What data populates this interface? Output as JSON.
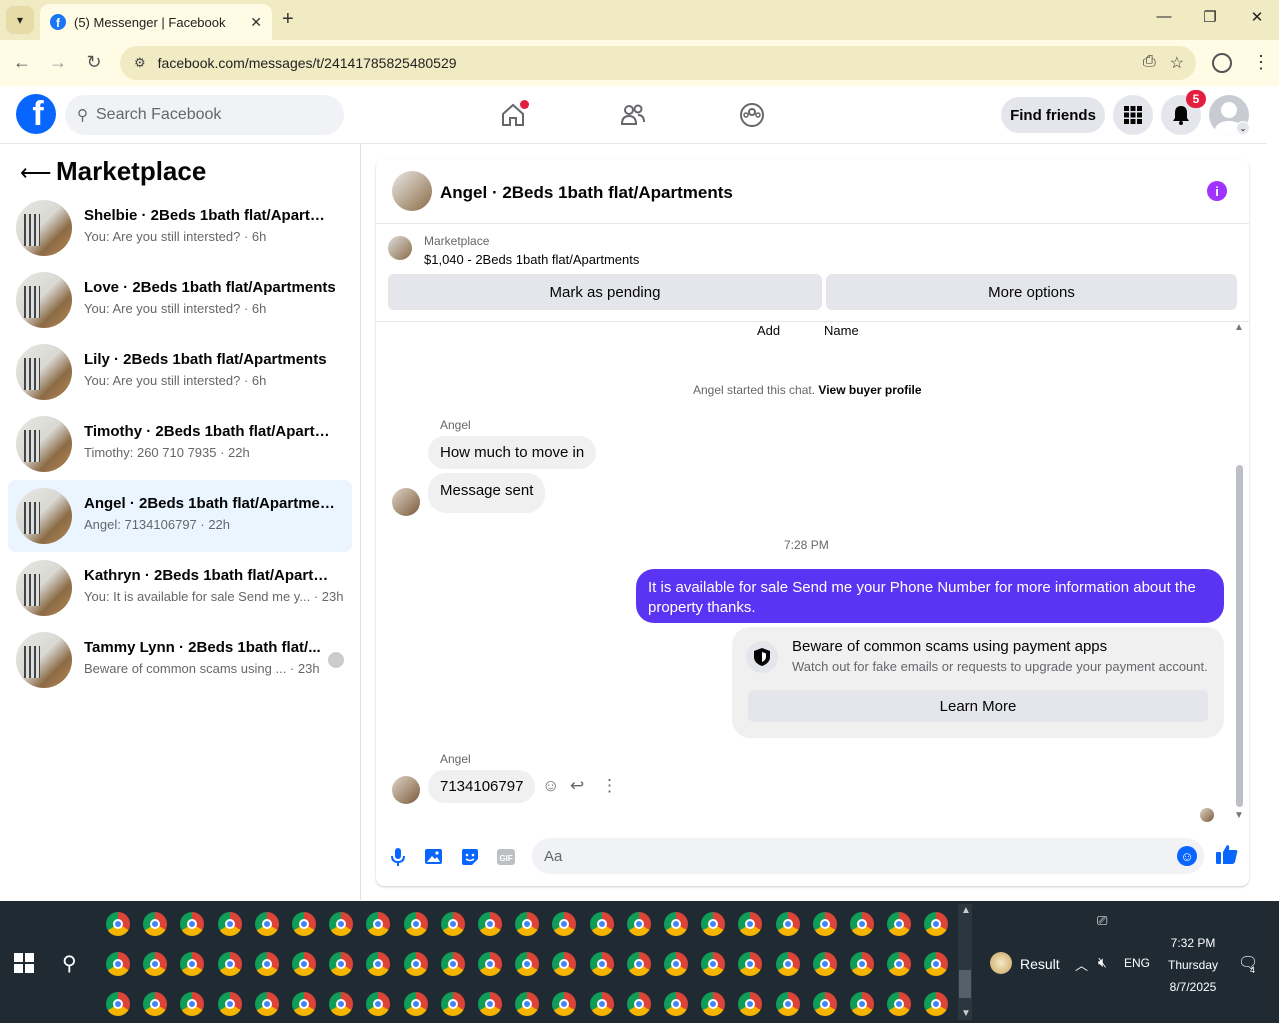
{
  "browser": {
    "tab_title": "(5) Messenger | Facebook",
    "url": "facebook.com/messages/t/24141785825480529",
    "new_tab_icon": "plus-icon"
  },
  "fb": {
    "search_placeholder": "Search Facebook",
    "find_friends": "Find friends",
    "notif_count": "5"
  },
  "sidebar": {
    "title": "Marketplace",
    "conversations": [
      {
        "name": "Shelbie · 2Beds 1bath flat/Apartme...",
        "preview": "You: Are you still intersted? · 6h"
      },
      {
        "name": "Love · 2Beds 1bath flat/Apartments",
        "preview": "You: Are you still intersted? · 6h"
      },
      {
        "name": "Lily · 2Beds 1bath flat/Apartments",
        "preview": "You: Are you still intersted? · 6h"
      },
      {
        "name": "Timothy · 2Beds 1bath flat/Apartm...",
        "preview": "Timothy: 260 710 7935 · 22h"
      },
      {
        "name": "Angel · 2Beds 1bath flat/Apartments",
        "preview": "Angel: 7134106797 · 22h"
      },
      {
        "name": "Kathryn · 2Beds 1bath flat/Apartm...",
        "preview": "You: It is available for sale Send me y... · 23h"
      },
      {
        "name": "Tammy Lynn · 2Beds 1bath flat/...",
        "preview": "Beware of common scams using ...  · 23h"
      }
    ]
  },
  "chat": {
    "title": "Angel · 2Beds 1bath flat/Apartments",
    "marketplace_label": "Marketplace",
    "listing": "$1,040 - 2Beds 1bath flat/Apartments",
    "mark_pending": "Mark as pending",
    "more_options": "More options",
    "add_label": "Add",
    "name_label": "Name",
    "started_text": "Angel started this chat.",
    "view_buyer": "View buyer profile",
    "sender1": "Angel",
    "msg1": "How much to move in",
    "msg2": "Message sent",
    "time": "7:28 PM",
    "outgoing": "It is available for sale Send me your Phone Number for more information about the property thanks.",
    "scam_title": "Beware of common scams using payment apps",
    "scam_sub": "Watch out for fake emails or requests to upgrade your payment account.",
    "learn_more": "Learn More",
    "sender2": "Angel",
    "msg3": "7134106797",
    "input_placeholder": "Aa"
  },
  "taskbar": {
    "weather_label": "Result",
    "lang": "ENG",
    "time": "7:32 PM",
    "day": "Thursday",
    "date": "8/7/2025",
    "notif_count": "4"
  },
  "colors": {
    "fb_blue": "#0866ff",
    "outgoing_bubble": "#5b33f2",
    "badge_red": "#e41e3f",
    "selected_bg": "#ebf5ff"
  }
}
